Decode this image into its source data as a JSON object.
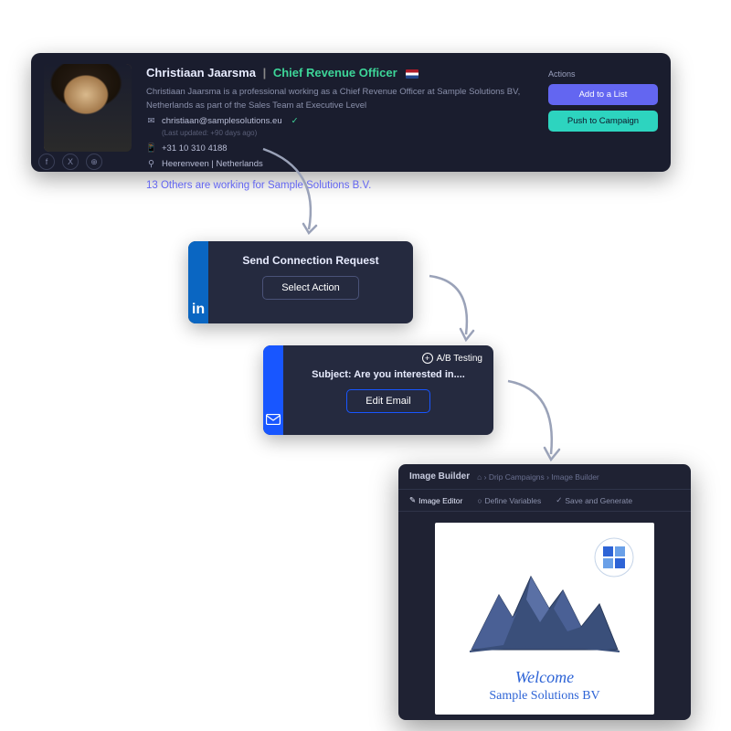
{
  "profile": {
    "name": "Christiaan Jaarsma",
    "title": "Chief Revenue Officer",
    "bio": "Christiaan Jaarsma is a professional working as a Chief Revenue Officer at Sample Solutions BV, Netherlands as part of the  Sales Team at Executive Level",
    "email": "christiaan@samplesolutions.eu",
    "updated": "(Last updated: +90 days ago)",
    "phone": "+31 10 310 4188",
    "location": "Heerenveen | Netherlands",
    "others": "13 Others are working for Sample Solutions B.V."
  },
  "actions": {
    "label": "Actions",
    "add": "Add to a List",
    "push": "Push to Campaign"
  },
  "step1": {
    "title": "Send Connection Request",
    "button": "Select Action"
  },
  "step2": {
    "ab": "A/B Testing",
    "subject": "Subject: Are you interested in....",
    "button": "Edit Email"
  },
  "builder": {
    "title": "Image Builder",
    "crumb": "⌂ › Drip Campaigns › Image Builder",
    "tab1": "Image Editor",
    "tab2": "Define Variables",
    "tab3": "Save and Generate",
    "welcome": "Welcome",
    "company": "Sample Solutions BV"
  }
}
